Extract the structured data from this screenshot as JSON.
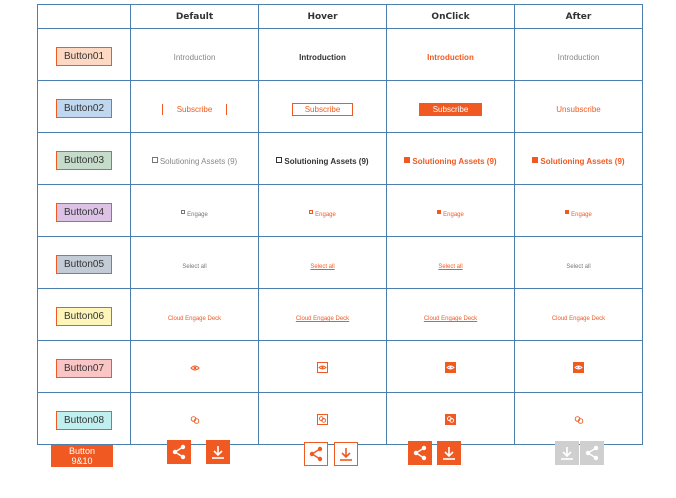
{
  "columns": [
    "",
    "Default",
    "Hover",
    "OnClick",
    "After"
  ],
  "rows": [
    {
      "button": "Button01",
      "color": "#fdd9c3",
      "default": "Introduction",
      "hover": "Introduction",
      "onclick": "Introduction",
      "after": "Introduction"
    },
    {
      "button": "Button02",
      "color": "#bfd7ef",
      "default": "Subscribe",
      "hover": "Subscribe",
      "onclick": "Subscribe",
      "after": "Unsubscribe"
    },
    {
      "button": "Button03",
      "color": "#c5dccb",
      "default": "Solutioning Assets (9)",
      "hover": "Solutioning Assets (9)",
      "onclick": "Solutioning Assets (9)",
      "after": "Solutioning Assets (9)"
    },
    {
      "button": "Button04",
      "color": "#dcc3e6",
      "default": "Engage",
      "hover": "Engage",
      "onclick": "Engage",
      "after": "Engage"
    },
    {
      "button": "Button05",
      "color": "#c3cbd6",
      "default": "Select all",
      "hover": "Select all",
      "onclick": "Select all",
      "after": "Select all"
    },
    {
      "button": "Button06",
      "color": "#fdf6b8",
      "default": "Cloud Engage Deck",
      "hover": "Cloud Engage Deck",
      "onclick": "Cloud Engage Deck",
      "after": "Cloud Engage Deck"
    },
    {
      "button": "Button07",
      "color": "#fbc5c5",
      "icon": "eye-icon"
    },
    {
      "button": "Button08",
      "color": "#bff0ef",
      "icon": "link-icon"
    }
  ],
  "footer": {
    "button_9_10_line1": "Button",
    "button_9_10_line2": "9&10",
    "icons": [
      "share-icon",
      "download-icon"
    ]
  },
  "colors": {
    "accent": "#f05a22",
    "grid": "#4a7fae",
    "disabled": "#cfcfcf"
  }
}
